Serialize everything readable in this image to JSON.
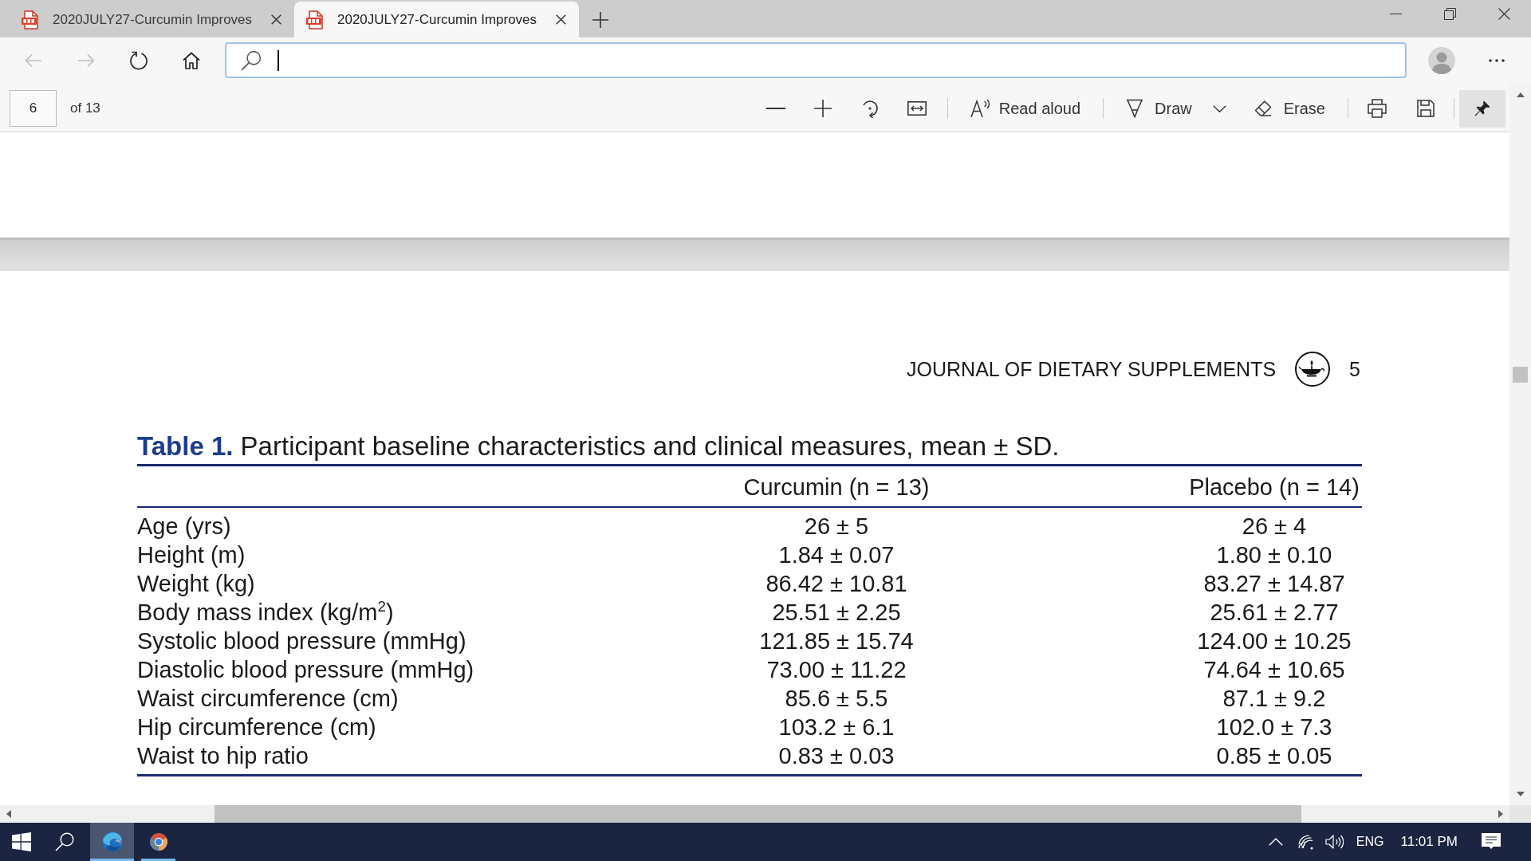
{
  "tabs": [
    {
      "title": "2020JULY27-Curcumin Improves",
      "selected": false
    },
    {
      "title": "2020JULY27-Curcumin Improves",
      "selected": true
    }
  ],
  "nav_buttons": [
    {
      "kind": "back",
      "disabled": true
    },
    {
      "kind": "forward",
      "disabled": true
    },
    {
      "kind": "refresh",
      "disabled": false
    },
    {
      "kind": "home",
      "disabled": false
    }
  ],
  "pdf_toolbar": {
    "page": "6",
    "page_total": "of 13",
    "buttons": [
      {
        "kind": "read",
        "label": "Read aloud"
      },
      {
        "kind": "draw",
        "label": "Draw"
      },
      {
        "kind": "erase",
        "label": "Erase"
      }
    ],
    "pinned": true
  },
  "document": {
    "running_head": {
      "journal": "JOURNAL OF DIETARY SUPPLEMENTS",
      "page": "5"
    },
    "table": {
      "label": "Table 1.",
      "caption": "Participant baseline characteristics and clinical measures, mean ± SD.",
      "columns": [
        "Curcumin (n = 13)",
        "Placebo (n = 14)"
      ],
      "rows": [
        {
          "label": "Age (yrs)",
          "values": [
            "26 ± 5",
            "26 ± 4"
          ]
        },
        {
          "label": "Height (m)",
          "values": [
            "1.84 ± 0.07",
            "1.80 ± 0.10"
          ]
        },
        {
          "label": "Weight (kg)",
          "values": [
            "86.42 ± 10.81",
            "83.27 ± 14.87"
          ]
        },
        {
          "label": "Body mass index (kg/m$^{2}$)",
          "values": [
            "25.51 ± 2.25",
            "25.61 ± 2.77"
          ]
        },
        {
          "label": "Systolic blood pressure (mmHg)",
          "values": [
            "121.85 ± 15.74",
            "124.00 ± 10.25"
          ]
        },
        {
          "label": "Diastolic blood pressure (mmHg)",
          "values": [
            "73.00 ± 11.22",
            "74.64 ± 10.65"
          ]
        },
        {
          "label": "Waist circumference (cm)",
          "values": [
            "85.6 ± 5.5",
            "87.1 ± 9.2"
          ]
        },
        {
          "label": "Hip circumference (cm)",
          "values": [
            "103.2 ± 6.1",
            "102.0 ± 7.3"
          ]
        },
        {
          "label": "Waist to hip ratio",
          "values": [
            "0.83 ± 0.03",
            "0.85 ± 0.05"
          ]
        }
      ]
    }
  },
  "taskbar": {
    "apps": [
      {
        "kind": "swirl",
        "selected": true,
        "running": true
      },
      {
        "kind": "ring",
        "selected": false,
        "running": true
      }
    ],
    "language": "ENG",
    "time": "11:01 PM"
  }
}
